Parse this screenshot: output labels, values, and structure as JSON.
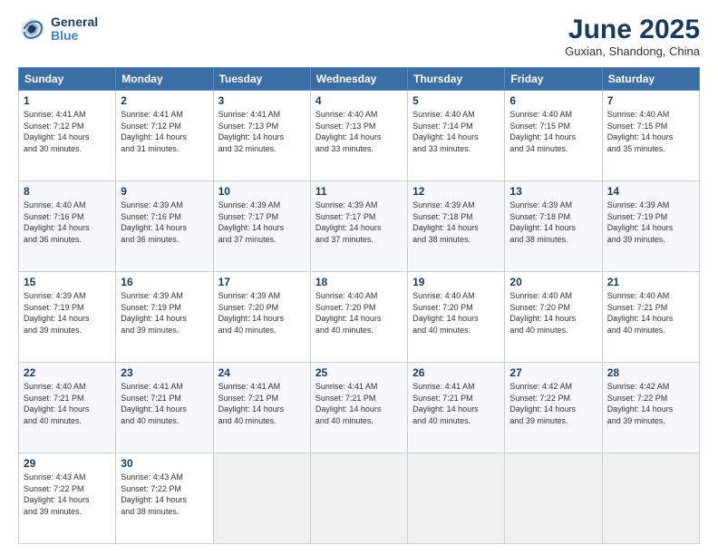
{
  "header": {
    "logo_general": "General",
    "logo_blue": "Blue",
    "month_title": "June 2025",
    "subtitle": "Guxian, Shandong, China"
  },
  "weekdays": [
    "Sunday",
    "Monday",
    "Tuesday",
    "Wednesday",
    "Thursday",
    "Friday",
    "Saturday"
  ],
  "weeks": [
    [
      {
        "day": "1",
        "lines": [
          "Sunrise: 4:41 AM",
          "Sunset: 7:12 PM",
          "Daylight: 14 hours",
          "and 30 minutes."
        ]
      },
      {
        "day": "2",
        "lines": [
          "Sunrise: 4:41 AM",
          "Sunset: 7:12 PM",
          "Daylight: 14 hours",
          "and 31 minutes."
        ]
      },
      {
        "day": "3",
        "lines": [
          "Sunrise: 4:41 AM",
          "Sunset: 7:13 PM",
          "Daylight: 14 hours",
          "and 32 minutes."
        ]
      },
      {
        "day": "4",
        "lines": [
          "Sunrise: 4:40 AM",
          "Sunset: 7:13 PM",
          "Daylight: 14 hours",
          "and 33 minutes."
        ]
      },
      {
        "day": "5",
        "lines": [
          "Sunrise: 4:40 AM",
          "Sunset: 7:14 PM",
          "Daylight: 14 hours",
          "and 33 minutes."
        ]
      },
      {
        "day": "6",
        "lines": [
          "Sunrise: 4:40 AM",
          "Sunset: 7:15 PM",
          "Daylight: 14 hours",
          "and 34 minutes."
        ]
      },
      {
        "day": "7",
        "lines": [
          "Sunrise: 4:40 AM",
          "Sunset: 7:15 PM",
          "Daylight: 14 hours",
          "and 35 minutes."
        ]
      }
    ],
    [
      {
        "day": "8",
        "lines": [
          "Sunrise: 4:40 AM",
          "Sunset: 7:16 PM",
          "Daylight: 14 hours",
          "and 36 minutes."
        ]
      },
      {
        "day": "9",
        "lines": [
          "Sunrise: 4:39 AM",
          "Sunset: 7:16 PM",
          "Daylight: 14 hours",
          "and 36 minutes."
        ]
      },
      {
        "day": "10",
        "lines": [
          "Sunrise: 4:39 AM",
          "Sunset: 7:17 PM",
          "Daylight: 14 hours",
          "and 37 minutes."
        ]
      },
      {
        "day": "11",
        "lines": [
          "Sunrise: 4:39 AM",
          "Sunset: 7:17 PM",
          "Daylight: 14 hours",
          "and 37 minutes."
        ]
      },
      {
        "day": "12",
        "lines": [
          "Sunrise: 4:39 AM",
          "Sunset: 7:18 PM",
          "Daylight: 14 hours",
          "and 38 minutes."
        ]
      },
      {
        "day": "13",
        "lines": [
          "Sunrise: 4:39 AM",
          "Sunset: 7:18 PM",
          "Daylight: 14 hours",
          "and 38 minutes."
        ]
      },
      {
        "day": "14",
        "lines": [
          "Sunrise: 4:39 AM",
          "Sunset: 7:19 PM",
          "Daylight: 14 hours",
          "and 39 minutes."
        ]
      }
    ],
    [
      {
        "day": "15",
        "lines": [
          "Sunrise: 4:39 AM",
          "Sunset: 7:19 PM",
          "Daylight: 14 hours",
          "and 39 minutes."
        ]
      },
      {
        "day": "16",
        "lines": [
          "Sunrise: 4:39 AM",
          "Sunset: 7:19 PM",
          "Daylight: 14 hours",
          "and 39 minutes."
        ]
      },
      {
        "day": "17",
        "lines": [
          "Sunrise: 4:39 AM",
          "Sunset: 7:20 PM",
          "Daylight: 14 hours",
          "and 40 minutes."
        ]
      },
      {
        "day": "18",
        "lines": [
          "Sunrise: 4:40 AM",
          "Sunset: 7:20 PM",
          "Daylight: 14 hours",
          "and 40 minutes."
        ]
      },
      {
        "day": "19",
        "lines": [
          "Sunrise: 4:40 AM",
          "Sunset: 7:20 PM",
          "Daylight: 14 hours",
          "and 40 minutes."
        ]
      },
      {
        "day": "20",
        "lines": [
          "Sunrise: 4:40 AM",
          "Sunset: 7:20 PM",
          "Daylight: 14 hours",
          "and 40 minutes."
        ]
      },
      {
        "day": "21",
        "lines": [
          "Sunrise: 4:40 AM",
          "Sunset: 7:21 PM",
          "Daylight: 14 hours",
          "and 40 minutes."
        ]
      }
    ],
    [
      {
        "day": "22",
        "lines": [
          "Sunrise: 4:40 AM",
          "Sunset: 7:21 PM",
          "Daylight: 14 hours",
          "and 40 minutes."
        ]
      },
      {
        "day": "23",
        "lines": [
          "Sunrise: 4:41 AM",
          "Sunset: 7:21 PM",
          "Daylight: 14 hours",
          "and 40 minutes."
        ]
      },
      {
        "day": "24",
        "lines": [
          "Sunrise: 4:41 AM",
          "Sunset: 7:21 PM",
          "Daylight: 14 hours",
          "and 40 minutes."
        ]
      },
      {
        "day": "25",
        "lines": [
          "Sunrise: 4:41 AM",
          "Sunset: 7:21 PM",
          "Daylight: 14 hours",
          "and 40 minutes."
        ]
      },
      {
        "day": "26",
        "lines": [
          "Sunrise: 4:41 AM",
          "Sunset: 7:21 PM",
          "Daylight: 14 hours",
          "and 40 minutes."
        ]
      },
      {
        "day": "27",
        "lines": [
          "Sunrise: 4:42 AM",
          "Sunset: 7:22 PM",
          "Daylight: 14 hours",
          "and 39 minutes."
        ]
      },
      {
        "day": "28",
        "lines": [
          "Sunrise: 4:42 AM",
          "Sunset: 7:22 PM",
          "Daylight: 14 hours",
          "and 39 minutes."
        ]
      }
    ],
    [
      {
        "day": "29",
        "lines": [
          "Sunrise: 4:43 AM",
          "Sunset: 7:22 PM",
          "Daylight: 14 hours",
          "and 39 minutes."
        ]
      },
      {
        "day": "30",
        "lines": [
          "Sunrise: 4:43 AM",
          "Sunset: 7:22 PM",
          "Daylight: 14 hours",
          "and 38 minutes."
        ]
      },
      {
        "day": "",
        "lines": []
      },
      {
        "day": "",
        "lines": []
      },
      {
        "day": "",
        "lines": []
      },
      {
        "day": "",
        "lines": []
      },
      {
        "day": "",
        "lines": []
      }
    ]
  ]
}
